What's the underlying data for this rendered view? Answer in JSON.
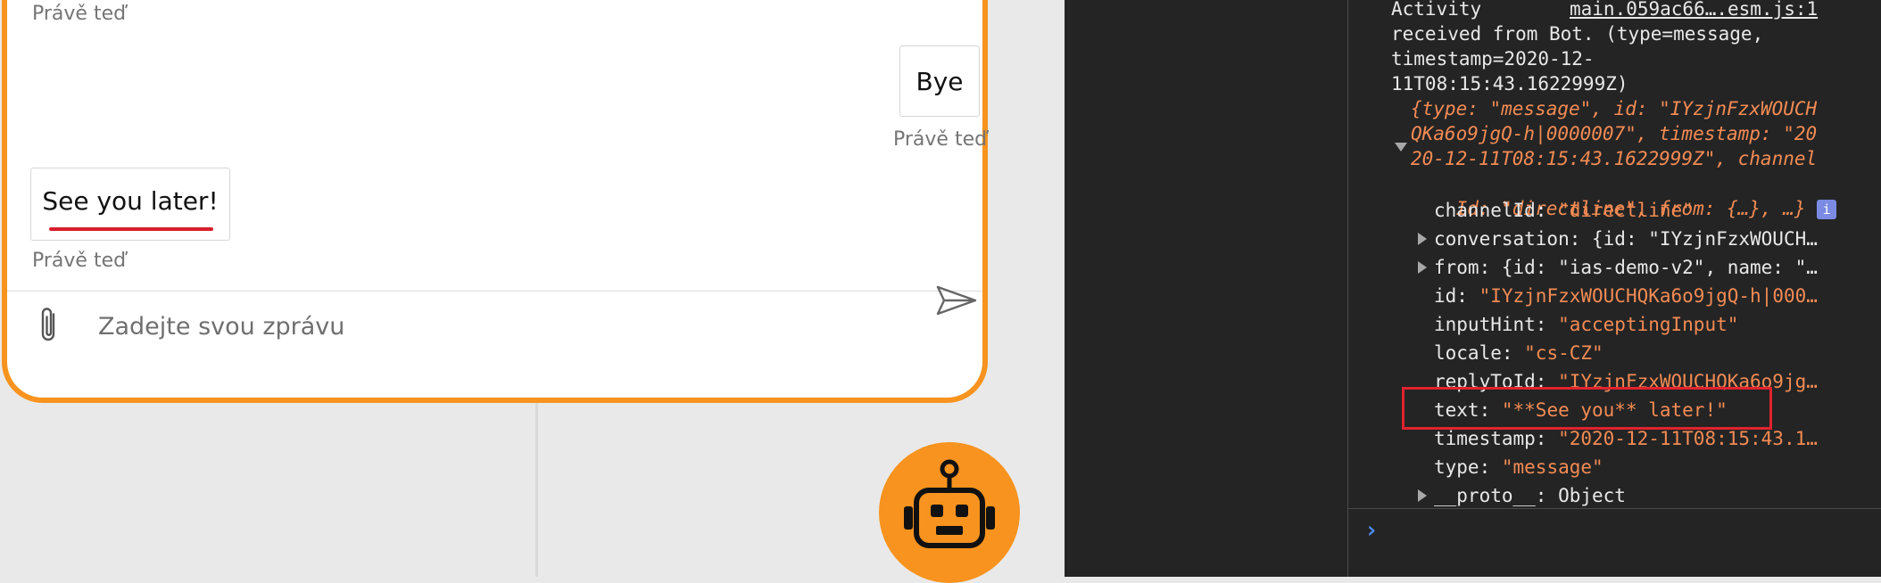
{
  "chat": {
    "messages": [
      {
        "from": "bot",
        "timestamp": "Právě teď"
      },
      {
        "from": "user",
        "text": "Bye",
        "timestamp": "Právě teď"
      },
      {
        "from": "bot",
        "text": "See you later!",
        "timestamp": "Právě teď"
      }
    ],
    "input": {
      "placeholder": "Zadejte svou zprávu",
      "value": ""
    },
    "icons": {
      "attach": "paperclip-icon",
      "send": "send-icon",
      "avatar": "robot-icon"
    },
    "colors": {
      "accent": "#f7931e",
      "underline": "#d81e2a"
    }
  },
  "devtools": {
    "header": {
      "source_link": "main.059ac66….esm.js:1",
      "line1": "Activity",
      "line2": "received from Bot. (type=message,",
      "line3": "timestamp=2020-12-",
      "line4": "11T08:15:43.1622999Z)"
    },
    "summary": {
      "line1": "{type: \"message\", id: \"IYzjnFzxWOUCH",
      "line2": "QKa6o9jgQ-h|0000007\", timestamp: \"20",
      "line3": "20-12-11T08:15:43.1622999Z\", channel",
      "line4": "Id: \"directline\", from: {…}, …}",
      "info_badge": "i"
    },
    "properties": [
      {
        "key": "channelId",
        "value": "\"directline\"",
        "expandable": false
      },
      {
        "key": "conversation",
        "value": "{id: \"IYzjnFzxWOUCH…",
        "expandable": true
      },
      {
        "key": "from",
        "value": "{id: \"ias-demo-v2\", name: \"…",
        "expandable": true
      },
      {
        "key": "id",
        "value": "\"IYzjnFzxWOUCHQKa6o9jgQ-h|000…",
        "expandable": false
      },
      {
        "key": "inputHint",
        "value": "\"acceptingInput\"",
        "expandable": false
      },
      {
        "key": "locale",
        "value": "\"cs-CZ\"",
        "expandable": false
      },
      {
        "key": "replyToId",
        "value": "\"IYzjnFzxWOUCHQKa6o9jg…",
        "expandable": false
      },
      {
        "key": "text",
        "value": "\"**See you** later!\"",
        "expandable": false
      },
      {
        "key": "timestamp",
        "value": "\"2020-12-11T08:15:43.1…",
        "expandable": false
      },
      {
        "key": "type",
        "value": "\"message\"",
        "expandable": false
      },
      {
        "key": "__proto__",
        "value": "Object",
        "expandable": true
      }
    ],
    "prompt": "›",
    "colors": {
      "background": "#242424",
      "string": "#f28b54",
      "highlight": "#e0232e",
      "prompt": "#4a8df6"
    }
  }
}
